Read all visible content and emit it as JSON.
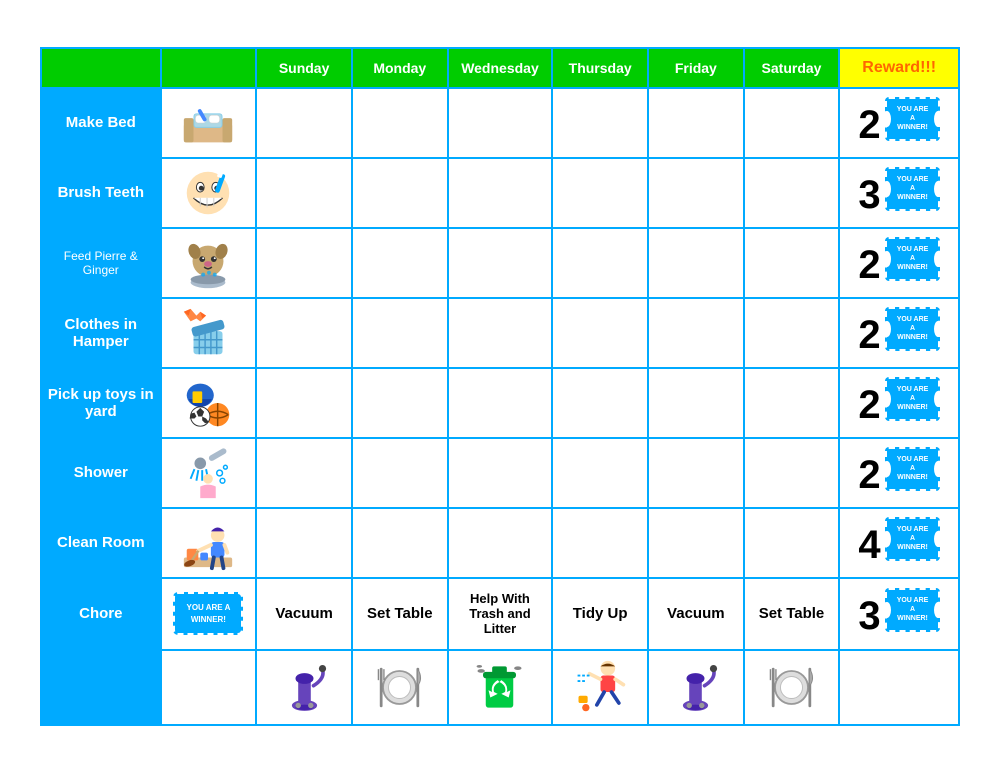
{
  "table": {
    "headers": {
      "col1": "",
      "col2": "",
      "sunday": "Sunday",
      "monday": "Monday",
      "wednesday": "Wednesday",
      "thursday": "Thursday",
      "friday": "Friday",
      "saturday": "Saturday",
      "reward": "Reward!!!"
    },
    "rows": [
      {
        "id": "make-bed",
        "label": "Make Bed",
        "labelStyle": "normal",
        "reward_number": "2",
        "icon": "bed"
      },
      {
        "id": "brush-teeth",
        "label": "Brush Teeth",
        "labelStyle": "normal",
        "reward_number": "3",
        "icon": "teeth"
      },
      {
        "id": "feed-pets",
        "label": "Feed Pierre & Ginger",
        "labelStyle": "small",
        "reward_number": "2",
        "icon": "pet"
      },
      {
        "id": "clothes-hamper",
        "label": "Clothes in Hamper",
        "labelStyle": "normal",
        "reward_number": "2",
        "icon": "hamper"
      },
      {
        "id": "pick-up-toys",
        "label": "Pick up toys in yard",
        "labelStyle": "normal",
        "reward_number": "2",
        "icon": "toys"
      },
      {
        "id": "shower",
        "label": "Shower",
        "labelStyle": "normal",
        "reward_number": "2",
        "icon": "shower"
      },
      {
        "id": "clean-room",
        "label": "Clean Room",
        "labelStyle": "normal",
        "reward_number": "4",
        "icon": "room"
      },
      {
        "id": "chore",
        "label": "Chore",
        "labelStyle": "normal",
        "reward_number": "3",
        "icon": "ticket",
        "sunday_text": "Vacuum",
        "monday_text": "Set Table",
        "wednesday_text": "Help With Trash and Litter",
        "thursday_text": "Tidy Up",
        "friday_text": "Vacuum",
        "saturday_text": "Set Table"
      }
    ],
    "winner_text": "YOU ARE A WINNER!"
  }
}
